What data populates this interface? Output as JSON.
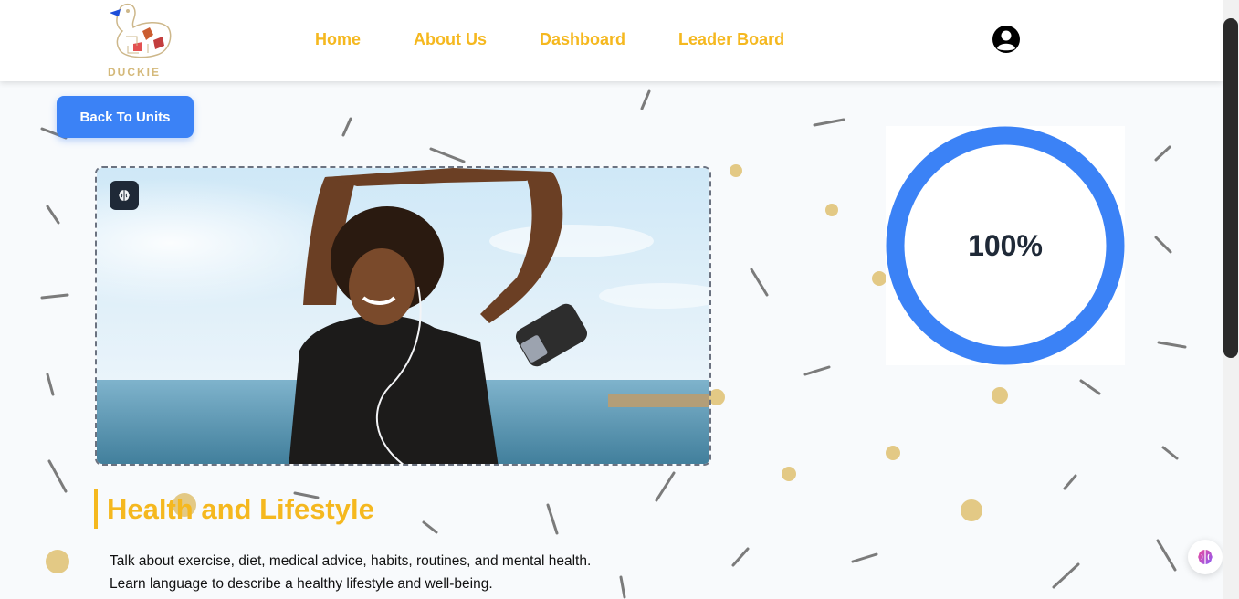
{
  "brand": {
    "name": "DUCKIE"
  },
  "nav": {
    "items": [
      {
        "label": "Home"
      },
      {
        "label": "About Us"
      },
      {
        "label": "Dashboard"
      },
      {
        "label": "Leader Board"
      }
    ]
  },
  "icons": {
    "user": "user-circle-icon",
    "brain": "brain-icon",
    "assistant": "brain-assistant-icon"
  },
  "back_button": {
    "label": "Back To Units"
  },
  "unit": {
    "title": "Health and Lifestyle",
    "description_lines": [
      "Talk about exercise, diet, medical advice, habits, routines, and mental health.",
      "Learn language to describe a healthy lifestyle and well-being."
    ]
  },
  "progress": {
    "value": 1.0,
    "label": "100%"
  },
  "colors": {
    "accent": "#f5b81f",
    "primary": "#3b82f6",
    "dark": "#1f2937"
  }
}
